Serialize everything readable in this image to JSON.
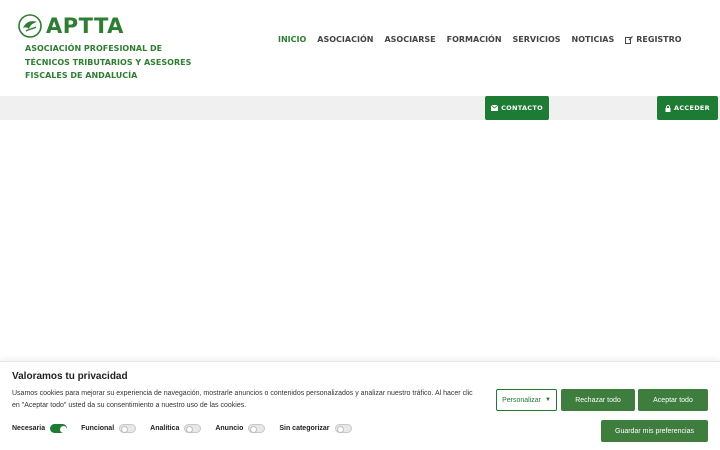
{
  "header": {
    "logo_text": "APTTA",
    "assoc_name": "ASOCIACIÓN PROFESIONAL DE TÉCNICOS TRIBUTARIOS Y ASESORES FISCALES DE ANDALUCÍA",
    "nav": [
      {
        "label": "INICIO",
        "active": true
      },
      {
        "label": "ASOCIACIÓN"
      },
      {
        "label": "ASOCIARSE"
      },
      {
        "label": "FORMACIÓN"
      },
      {
        "label": "SERVICIOS"
      },
      {
        "label": "NOTICIAS"
      },
      {
        "label": "REGISTRO",
        "icon": "edit-icon"
      }
    ]
  },
  "bar": {
    "contacto_label": "CONTACTO",
    "contacto_icon": "envelope-icon",
    "acceder_label": "ACCEDER",
    "acceder_icon": "lock-icon"
  },
  "cookie": {
    "title": "Valoramos tu privacidad",
    "text": "Usamos cookies para mejorar su experiencia de navegación, mostrarle anuncios o contenidos personalizados y analizar nuestro tráfico. Al hacer clic en \"Aceptar todo\" usted da su consentimiento a nuestro uso de las cookies.",
    "toggles": [
      {
        "label": "Necesaria",
        "on": true
      },
      {
        "label": "Funcional",
        "on": false
      },
      {
        "label": "Analítica",
        "on": false
      },
      {
        "label": "Anuncio",
        "on": false
      },
      {
        "label": "Sin categorizar",
        "on": false
      }
    ],
    "personalizar_label": "Personalizar",
    "rechazar_label": "Rechazar todo",
    "aceptar_label": "Aceptar todo",
    "guardar_label": "Guardar mis preferencias"
  },
  "colors": {
    "brand_green": "#2e7d32",
    "button_green": "#1e7b34",
    "bar_gray": "#f0f0f0"
  }
}
